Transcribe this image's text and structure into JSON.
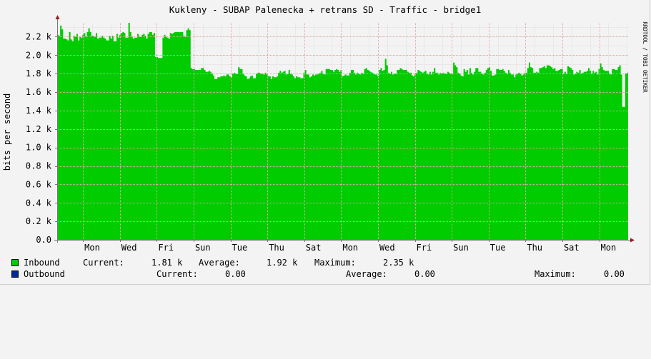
{
  "chart_data": {
    "type": "area",
    "title": "Kukleny - SUBAP Palenecka + retrans SD - Traffic - bridge1",
    "ylabel": "bits per second",
    "watermark": "RRDTOOL / TOBI OETIKER",
    "ylim": [
      0,
      2.35
    ],
    "y_unit": "k",
    "y_ticks": [
      "0.0",
      "0.2 k",
      "0.4 k",
      "0.6 k",
      "0.8 k",
      "1.0 k",
      "1.2 k",
      "1.4 k",
      "1.6 k",
      "1.8 k",
      "2.0 k",
      "2.2 k"
    ],
    "y_tick_values": [
      0,
      0.2,
      0.4,
      0.6,
      0.8,
      1.0,
      1.2,
      1.4,
      1.6,
      1.8,
      2.0,
      2.2
    ],
    "x_ticks": [
      "Mon",
      "Wed",
      "Fri",
      "Sun",
      "Tue",
      "Thu",
      "Sat",
      "Mon",
      "Wed",
      "Fri",
      "Sun",
      "Tue",
      "Thu",
      "Sat",
      "Mon"
    ],
    "grid": true,
    "colors": {
      "inbound": "#00cc00",
      "outbound": "#002a97",
      "grid": "#e2a8a8",
      "axis": "#777777",
      "arrow": "#9a1c1c"
    },
    "series": [
      {
        "name": "Inbound",
        "values": [
          2.22,
          2.21,
          2.32,
          2.28,
          2.18,
          2.18,
          2.17,
          2.16,
          2.25,
          2.17,
          2.15,
          2.21,
          2.2,
          2.23,
          2.16,
          2.2,
          2.19,
          2.22,
          2.24,
          2.2,
          2.25,
          2.29,
          2.25,
          2.21,
          2.21,
          2.2,
          2.24,
          2.18,
          2.19,
          2.19,
          2.21,
          2.19,
          2.18,
          2.16,
          2.16,
          2.21,
          2.18,
          2.21,
          2.15,
          2.15,
          2.23,
          2.19,
          2.22,
          2.24,
          2.25,
          2.24,
          2.19,
          2.19,
          2.35,
          2.25,
          2.2,
          2.18,
          2.19,
          2.19,
          2.23,
          2.2,
          2.2,
          2.22,
          2.23,
          2.21,
          2.18,
          2.23,
          2.25,
          2.25,
          2.22,
          2.24,
          1.98,
          1.98,
          1.97,
          1.97,
          1.97,
          2.19,
          2.22,
          2.2,
          2.19,
          2.18,
          2.24,
          2.23,
          2.24,
          2.25,
          2.25,
          2.25,
          2.25,
          2.25,
          2.25,
          2.21,
          2.2,
          2.27,
          2.29,
          2.27,
          1.86,
          1.85,
          1.85,
          1.84,
          1.84,
          1.84,
          1.84,
          1.86,
          1.86,
          1.84,
          1.82,
          1.82,
          1.83,
          1.82,
          1.8,
          1.78,
          1.74,
          1.74,
          1.76,
          1.76,
          1.77,
          1.77,
          1.78,
          1.77,
          1.79,
          1.79,
          1.77,
          1.76,
          1.8,
          1.81,
          1.8,
          1.8,
          1.87,
          1.85,
          1.85,
          1.8,
          1.78,
          1.77,
          1.74,
          1.75,
          1.77,
          1.78,
          1.75,
          1.75,
          1.8,
          1.81,
          1.81,
          1.8,
          1.8,
          1.79,
          1.81,
          1.79,
          1.77,
          1.77,
          1.74,
          1.77,
          1.76,
          1.76,
          1.77,
          1.81,
          1.83,
          1.81,
          1.82,
          1.83,
          1.79,
          1.8,
          1.84,
          1.8,
          1.79,
          1.77,
          1.75,
          1.77,
          1.76,
          1.76,
          1.75,
          1.75,
          1.81,
          1.84,
          1.79,
          1.79,
          1.76,
          1.77,
          1.79,
          1.78,
          1.79,
          1.79,
          1.8,
          1.81,
          1.83,
          1.8,
          1.79,
          1.85,
          1.85,
          1.85,
          1.84,
          1.84,
          1.82,
          1.84,
          1.85,
          1.84,
          1.82,
          1.84,
          1.77,
          1.78,
          1.79,
          1.78,
          1.78,
          1.81,
          1.84,
          1.84,
          1.81,
          1.79,
          1.81,
          1.8,
          1.79,
          1.81,
          1.8,
          1.85,
          1.86,
          1.84,
          1.83,
          1.82,
          1.81,
          1.8,
          1.79,
          1.79,
          1.77,
          1.84,
          1.86,
          1.83,
          1.84,
          1.96,
          1.89,
          1.81,
          1.8,
          1.82,
          1.79,
          1.8,
          1.8,
          1.84,
          1.84,
          1.86,
          1.85,
          1.84,
          1.84,
          1.84,
          1.82,
          1.81,
          1.81,
          1.78,
          1.77,
          1.8,
          1.81,
          1.84,
          1.83,
          1.82,
          1.81,
          1.82,
          1.83,
          1.8,
          1.79,
          1.82,
          1.79,
          1.82,
          1.86,
          1.81,
          1.81,
          1.79,
          1.81,
          1.8,
          1.81,
          1.8,
          1.8,
          1.82,
          1.81,
          1.8,
          1.8,
          1.92,
          1.89,
          1.87,
          1.81,
          1.8,
          1.78,
          1.77,
          1.85,
          1.82,
          1.84,
          1.79,
          1.86,
          1.81,
          1.79,
          1.82,
          1.86,
          1.86,
          1.82,
          1.82,
          1.8,
          1.79,
          1.81,
          1.84,
          1.86,
          1.87,
          1.83,
          1.78,
          1.78,
          1.79,
          1.85,
          1.85,
          1.84,
          1.84,
          1.85,
          1.83,
          1.81,
          1.8,
          1.84,
          1.81,
          1.79,
          1.79,
          1.76,
          1.79,
          1.8,
          1.81,
          1.8,
          1.78,
          1.79,
          1.81,
          1.81,
          1.86,
          1.92,
          1.87,
          1.86,
          1.81,
          1.81,
          1.82,
          1.81,
          1.86,
          1.86,
          1.87,
          1.88,
          1.86,
          1.89,
          1.89,
          1.88,
          1.87,
          1.85,
          1.86,
          1.83,
          1.83,
          1.84,
          1.85,
          1.85,
          1.8,
          1.82,
          1.8,
          1.88,
          1.87,
          1.86,
          1.84,
          1.79,
          1.8,
          1.82,
          1.81,
          1.84,
          1.8,
          1.81,
          1.82,
          1.82,
          1.83,
          1.86,
          1.83,
          1.8,
          1.83,
          1.81,
          1.82,
          1.79,
          1.85,
          1.91,
          1.87,
          1.84,
          1.83,
          1.83,
          1.83,
          1.8,
          1.79,
          1.85,
          1.85,
          1.84,
          1.84,
          1.87,
          1.89,
          1.79,
          1.44,
          1.44,
          1.8,
          1.81
        ]
      },
      {
        "name": "Outbound",
        "values": []
      }
    ]
  },
  "legend": {
    "inbound": {
      "label": "Inbound",
      "current_label": "Current:",
      "current": "1.81 k",
      "average_label": "Average:",
      "average": "1.92 k",
      "maximum_label": "Maximum:",
      "maximum": "2.35 k"
    },
    "outbound": {
      "label": "Outbound",
      "current_label": "Current:",
      "current": "0.00",
      "average_label": "Average:",
      "average": "0.00",
      "maximum_label": "Maximum:",
      "maximum": "0.00"
    }
  }
}
